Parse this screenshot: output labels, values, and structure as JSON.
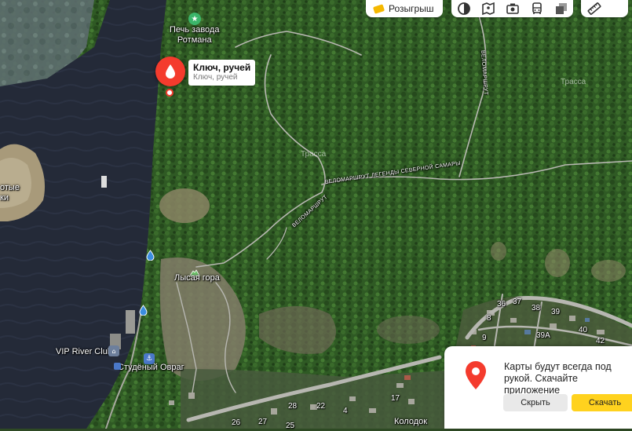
{
  "map": {
    "selected_place": {
      "title": "Ключ, ручей",
      "subtitle": "Ключ, ручей"
    },
    "place_labels": {
      "factory_oven_line1": "Печь завода",
      "factory_oven_line2": "Ротмана",
      "lysaya_gora": "Лысая гора",
      "vip_river_club": "VIP River Club",
      "studeny_ovrag": "Студёный Овраг",
      "kolodok": "Колодок"
    },
    "road_labels": {
      "legend_trail_long": "ВЕЛОМАРШРУТ ЛЕГЕНДЫ СЕВЕРНОЙ САМАРЫ",
      "legend_trail_short": "ВЕЛОМАРШРУТ"
    },
    "edge_text": {
      "left_fragment_1": "отые",
      "left_fragment_2": "ки"
    },
    "faint_labels": {
      "trail_a": "Трасса",
      "trail_b": "Трасса"
    },
    "house_numbers": {
      "n36": "36",
      "n37": "37",
      "n38": "38",
      "n39": "39",
      "n39a": "39А",
      "n40": "40",
      "n42": "42",
      "n8": "8",
      "n9": "9",
      "n17": "17",
      "n22": "22",
      "n26": "26",
      "n27": "27",
      "n25": "25",
      "n28": "28",
      "n4": "4"
    }
  },
  "toolbar": {
    "promo_label": "Розыгрыш",
    "tools": [
      "traffic-icon",
      "panorama-icon",
      "camera-icon",
      "transit-icon",
      "layers-icon"
    ],
    "ruler_tool": "ruler-icon"
  },
  "app_promo": {
    "message": "Карты будут всегда под рукой. Скачайте приложение",
    "hide_label": "Скрыть",
    "download_label": "Скачать"
  },
  "colors": {
    "accent_red": "#f43b2d",
    "download_yellow": "#ffd21e",
    "water_icon_blue": "#3b8de0",
    "sight_green": "#3bb56a"
  }
}
